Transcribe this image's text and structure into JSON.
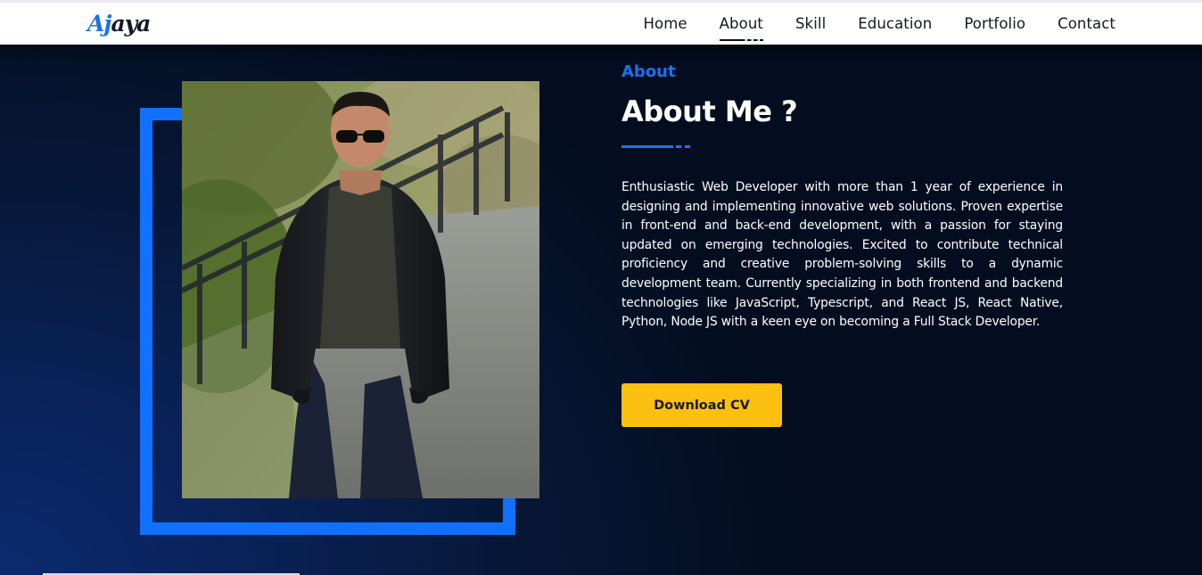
{
  "brand": {
    "logo_part1": "Aj",
    "logo_part2": "aya"
  },
  "nav": {
    "items": [
      {
        "label": "Home"
      },
      {
        "label": "About",
        "active": true
      },
      {
        "label": "Skill"
      },
      {
        "label": "Education"
      },
      {
        "label": "Portfolio"
      },
      {
        "label": "Contact"
      }
    ]
  },
  "about": {
    "label": "About",
    "title": "About Me ?",
    "bio": "Enthusiastic Web Developer with more than 1 year of experience in designing and implementing innovative web solutions. Proven expertise in front-end and back-end development, with a passion for staying updated on emerging technologies. Excited to contribute technical proficiency and creative problem-solving skills to a dynamic development team. Currently specializing in both frontend and backend technologies like JavaScript, Typescript, and React JS, React Native, Python, Node JS with a keen eye on becoming a Full Stack Developer.",
    "button_label": "Download CV"
  },
  "colors": {
    "accent": "#1a73f0",
    "frame": "#1070ff",
    "button": "#fcc010",
    "hero_dark": "#030d1f",
    "hero_blue": "#0b2a6e"
  }
}
